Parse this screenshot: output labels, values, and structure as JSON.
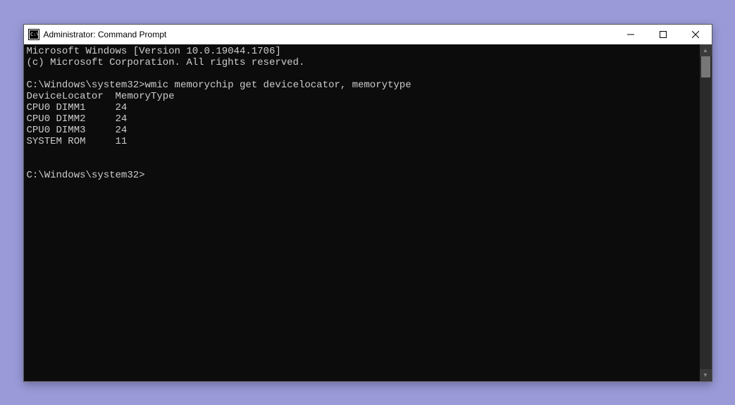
{
  "window": {
    "title": "Administrator: Command Prompt"
  },
  "terminal": {
    "header_line1": "Microsoft Windows [Version 10.0.19044.1706]",
    "header_line2": "(c) Microsoft Corporation. All rights reserved.",
    "blank": "",
    "prompt1_path": "C:\\Windows\\system32>",
    "prompt1_command": "wmic memorychip get devicelocator, memorytype",
    "output_header": "DeviceLocator  MemoryType",
    "output_rows": [
      {
        "locator": "CPU0 DIMM1",
        "type": "24"
      },
      {
        "locator": "CPU0 DIMM2",
        "type": "24"
      },
      {
        "locator": "CPU0 DIMM3",
        "type": "24"
      },
      {
        "locator": "SYSTEM ROM",
        "type": "11"
      }
    ],
    "output_row_0": "CPU0 DIMM1     24",
    "output_row_1": "CPU0 DIMM2     24",
    "output_row_2": "CPU0 DIMM3     24",
    "output_row_3": "SYSTEM ROM     11",
    "prompt2_path": "C:\\Windows\\system32>"
  }
}
